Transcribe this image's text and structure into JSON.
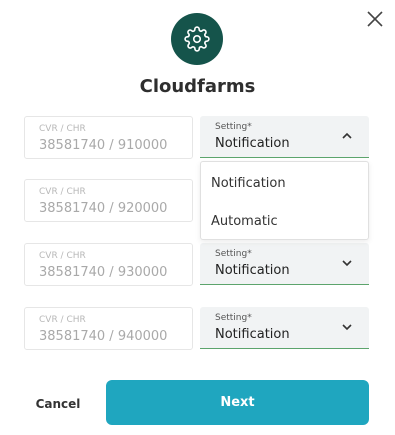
{
  "header": {
    "title": "Cloudfarms",
    "logo_icon": "gear-icon",
    "close_icon": "close-icon"
  },
  "rows": [
    {
      "cvr_label": "CVR / CHR",
      "cvr_value": "38581740 / 910000",
      "setting_label": "Setting*",
      "setting_value": "Notification",
      "expanded": true
    },
    {
      "cvr_label": "CVR / CHR",
      "cvr_value": "38581740 / 920000",
      "setting_label": "Setting*",
      "setting_value": "Notification",
      "expanded": false
    },
    {
      "cvr_label": "CVR / CHR",
      "cvr_value": "38581740 / 930000",
      "setting_label": "Setting*",
      "setting_value": "Notification",
      "expanded": false
    },
    {
      "cvr_label": "CVR / CHR",
      "cvr_value": "38581740 / 940000",
      "setting_label": "Setting*",
      "setting_value": "Notification",
      "expanded": false
    }
  ],
  "dropdown": {
    "options": [
      "Notification",
      "Automatic"
    ]
  },
  "footer": {
    "cancel_label": "Cancel",
    "next_label": "Next"
  },
  "colors": {
    "logo_bg": "#15544b",
    "accent": "#1fa6bf",
    "select_underline": "#5ca46c"
  }
}
